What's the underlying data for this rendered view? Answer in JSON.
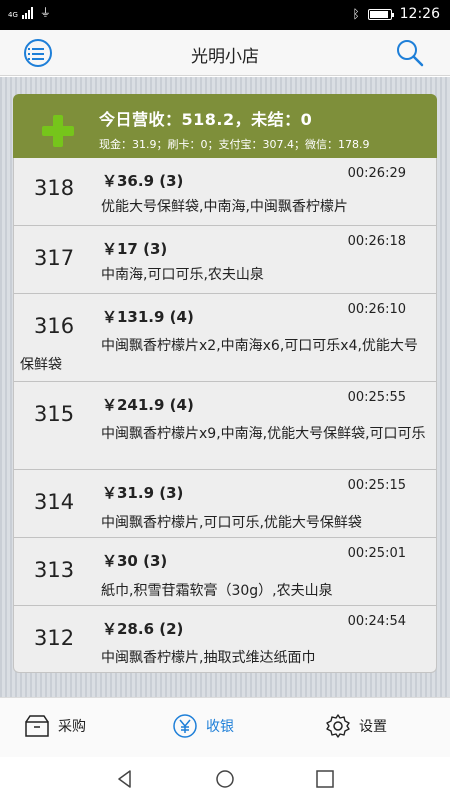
{
  "status_bar": {
    "network": "4G",
    "time": "12:26"
  },
  "header": {
    "title": "光明小店"
  },
  "summary": {
    "title": "今日营收：518.2，未结：0",
    "detail": "现金：31.9；刷卡：0；支付宝：307.4；微信：178.9"
  },
  "orders": [
    {
      "no": "318",
      "amount": "￥36.9 (3)",
      "time": "00:26:29",
      "items": "优能大号保鲜袋,中南海,中闽飘香柠檬片"
    },
    {
      "no": "317",
      "amount": "￥17 (3)",
      "time": "00:26:18",
      "items": "中南海,可口可乐,农夫山泉"
    },
    {
      "no": "316",
      "amount": "￥131.9 (4)",
      "time": "00:26:10",
      "items": "中闽飘香柠檬片x2,中南海x6,可口可乐x4,优能大号保鲜袋"
    },
    {
      "no": "315",
      "amount": "￥241.9 (4)",
      "time": "00:25:55",
      "items": "中闽飘香柠檬片x9,中南海,优能大号保鲜袋,可口可乐"
    },
    {
      "no": "314",
      "amount": "￥31.9 (3)",
      "time": "00:25:15",
      "items": "中闽飘香柠檬片,可口可乐,优能大号保鲜袋"
    },
    {
      "no": "313",
      "amount": "￥30 (3)",
      "time": "00:25:01",
      "items": "紙巾,积雪苷霜软膏（30g）,农夫山泉"
    },
    {
      "no": "312",
      "amount": "￥28.6 (2)",
      "time": "00:24:54",
      "items": "中闽飘香柠檬片,抽取式维达纸面巾"
    }
  ],
  "bottom_nav": {
    "purchase": "采购",
    "checkout": "收银",
    "settings": "设置"
  },
  "colors": {
    "accent": "#1e7fd8",
    "summary_bg": "#7e8f3a",
    "plus": "#76c51b"
  }
}
